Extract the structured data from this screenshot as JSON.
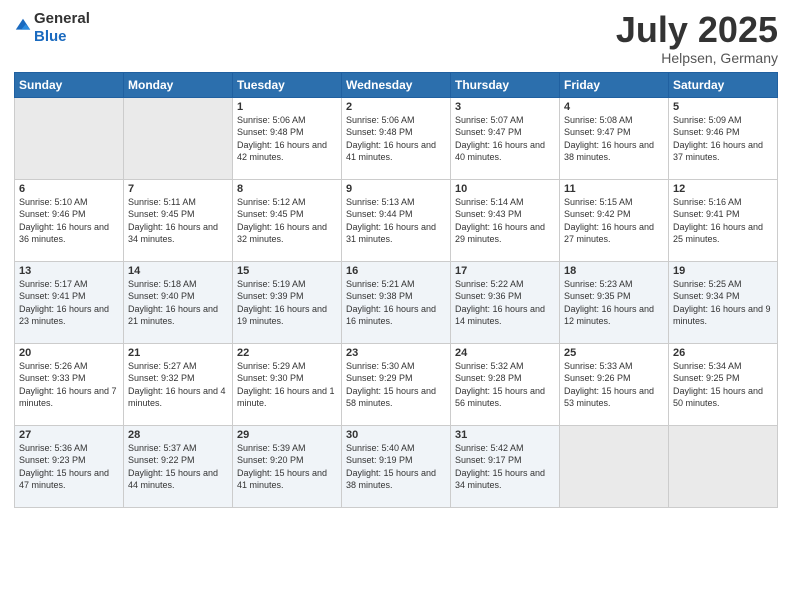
{
  "logo": {
    "general": "General",
    "blue": "Blue"
  },
  "title": {
    "month_year": "July 2025",
    "location": "Helpsen, Germany"
  },
  "weekdays": [
    "Sunday",
    "Monday",
    "Tuesday",
    "Wednesday",
    "Thursday",
    "Friday",
    "Saturday"
  ],
  "weeks": [
    [
      {
        "day": null
      },
      {
        "day": null
      },
      {
        "day": "1",
        "sunrise": "Sunrise: 5:06 AM",
        "sunset": "Sunset: 9:48 PM",
        "daylight": "Daylight: 16 hours and 42 minutes."
      },
      {
        "day": "2",
        "sunrise": "Sunrise: 5:06 AM",
        "sunset": "Sunset: 9:48 PM",
        "daylight": "Daylight: 16 hours and 41 minutes."
      },
      {
        "day": "3",
        "sunrise": "Sunrise: 5:07 AM",
        "sunset": "Sunset: 9:47 PM",
        "daylight": "Daylight: 16 hours and 40 minutes."
      },
      {
        "day": "4",
        "sunrise": "Sunrise: 5:08 AM",
        "sunset": "Sunset: 9:47 PM",
        "daylight": "Daylight: 16 hours and 38 minutes."
      },
      {
        "day": "5",
        "sunrise": "Sunrise: 5:09 AM",
        "sunset": "Sunset: 9:46 PM",
        "daylight": "Daylight: 16 hours and 37 minutes."
      }
    ],
    [
      {
        "day": "6",
        "sunrise": "Sunrise: 5:10 AM",
        "sunset": "Sunset: 9:46 PM",
        "daylight": "Daylight: 16 hours and 36 minutes."
      },
      {
        "day": "7",
        "sunrise": "Sunrise: 5:11 AM",
        "sunset": "Sunset: 9:45 PM",
        "daylight": "Daylight: 16 hours and 34 minutes."
      },
      {
        "day": "8",
        "sunrise": "Sunrise: 5:12 AM",
        "sunset": "Sunset: 9:45 PM",
        "daylight": "Daylight: 16 hours and 32 minutes."
      },
      {
        "day": "9",
        "sunrise": "Sunrise: 5:13 AM",
        "sunset": "Sunset: 9:44 PM",
        "daylight": "Daylight: 16 hours and 31 minutes."
      },
      {
        "day": "10",
        "sunrise": "Sunrise: 5:14 AM",
        "sunset": "Sunset: 9:43 PM",
        "daylight": "Daylight: 16 hours and 29 minutes."
      },
      {
        "day": "11",
        "sunrise": "Sunrise: 5:15 AM",
        "sunset": "Sunset: 9:42 PM",
        "daylight": "Daylight: 16 hours and 27 minutes."
      },
      {
        "day": "12",
        "sunrise": "Sunrise: 5:16 AM",
        "sunset": "Sunset: 9:41 PM",
        "daylight": "Daylight: 16 hours and 25 minutes."
      }
    ],
    [
      {
        "day": "13",
        "sunrise": "Sunrise: 5:17 AM",
        "sunset": "Sunset: 9:41 PM",
        "daylight": "Daylight: 16 hours and 23 minutes."
      },
      {
        "day": "14",
        "sunrise": "Sunrise: 5:18 AM",
        "sunset": "Sunset: 9:40 PM",
        "daylight": "Daylight: 16 hours and 21 minutes."
      },
      {
        "day": "15",
        "sunrise": "Sunrise: 5:19 AM",
        "sunset": "Sunset: 9:39 PM",
        "daylight": "Daylight: 16 hours and 19 minutes."
      },
      {
        "day": "16",
        "sunrise": "Sunrise: 5:21 AM",
        "sunset": "Sunset: 9:38 PM",
        "daylight": "Daylight: 16 hours and 16 minutes."
      },
      {
        "day": "17",
        "sunrise": "Sunrise: 5:22 AM",
        "sunset": "Sunset: 9:36 PM",
        "daylight": "Daylight: 16 hours and 14 minutes."
      },
      {
        "day": "18",
        "sunrise": "Sunrise: 5:23 AM",
        "sunset": "Sunset: 9:35 PM",
        "daylight": "Daylight: 16 hours and 12 minutes."
      },
      {
        "day": "19",
        "sunrise": "Sunrise: 5:25 AM",
        "sunset": "Sunset: 9:34 PM",
        "daylight": "Daylight: 16 hours and 9 minutes."
      }
    ],
    [
      {
        "day": "20",
        "sunrise": "Sunrise: 5:26 AM",
        "sunset": "Sunset: 9:33 PM",
        "daylight": "Daylight: 16 hours and 7 minutes."
      },
      {
        "day": "21",
        "sunrise": "Sunrise: 5:27 AM",
        "sunset": "Sunset: 9:32 PM",
        "daylight": "Daylight: 16 hours and 4 minutes."
      },
      {
        "day": "22",
        "sunrise": "Sunrise: 5:29 AM",
        "sunset": "Sunset: 9:30 PM",
        "daylight": "Daylight: 16 hours and 1 minute."
      },
      {
        "day": "23",
        "sunrise": "Sunrise: 5:30 AM",
        "sunset": "Sunset: 9:29 PM",
        "daylight": "Daylight: 15 hours and 58 minutes."
      },
      {
        "day": "24",
        "sunrise": "Sunrise: 5:32 AM",
        "sunset": "Sunset: 9:28 PM",
        "daylight": "Daylight: 15 hours and 56 minutes."
      },
      {
        "day": "25",
        "sunrise": "Sunrise: 5:33 AM",
        "sunset": "Sunset: 9:26 PM",
        "daylight": "Daylight: 15 hours and 53 minutes."
      },
      {
        "day": "26",
        "sunrise": "Sunrise: 5:34 AM",
        "sunset": "Sunset: 9:25 PM",
        "daylight": "Daylight: 15 hours and 50 minutes."
      }
    ],
    [
      {
        "day": "27",
        "sunrise": "Sunrise: 5:36 AM",
        "sunset": "Sunset: 9:23 PM",
        "daylight": "Daylight: 15 hours and 47 minutes."
      },
      {
        "day": "28",
        "sunrise": "Sunrise: 5:37 AM",
        "sunset": "Sunset: 9:22 PM",
        "daylight": "Daylight: 15 hours and 44 minutes."
      },
      {
        "day": "29",
        "sunrise": "Sunrise: 5:39 AM",
        "sunset": "Sunset: 9:20 PM",
        "daylight": "Daylight: 15 hours and 41 minutes."
      },
      {
        "day": "30",
        "sunrise": "Sunrise: 5:40 AM",
        "sunset": "Sunset: 9:19 PM",
        "daylight": "Daylight: 15 hours and 38 minutes."
      },
      {
        "day": "31",
        "sunrise": "Sunrise: 5:42 AM",
        "sunset": "Sunset: 9:17 PM",
        "daylight": "Daylight: 15 hours and 34 minutes."
      },
      {
        "day": null
      },
      {
        "day": null
      }
    ]
  ]
}
